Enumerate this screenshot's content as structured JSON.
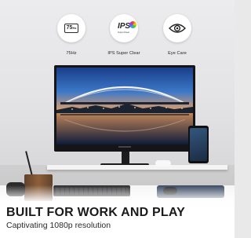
{
  "features": [
    {
      "label": "75Hz",
      "icon": "refresh-rate-75hz-icon",
      "badge": "75",
      "badge_unit": "Hz"
    },
    {
      "label": "IPS Super Clear",
      "icon": "ips-super-clear-icon",
      "badge": "IPS",
      "badge_sub": "SuperClear"
    },
    {
      "label": "Eye Care",
      "icon": "eye-care-icon"
    }
  ],
  "headline": "BUILT FOR WORK AND PLAY",
  "subheadline": "Captivating 1080p resolution"
}
